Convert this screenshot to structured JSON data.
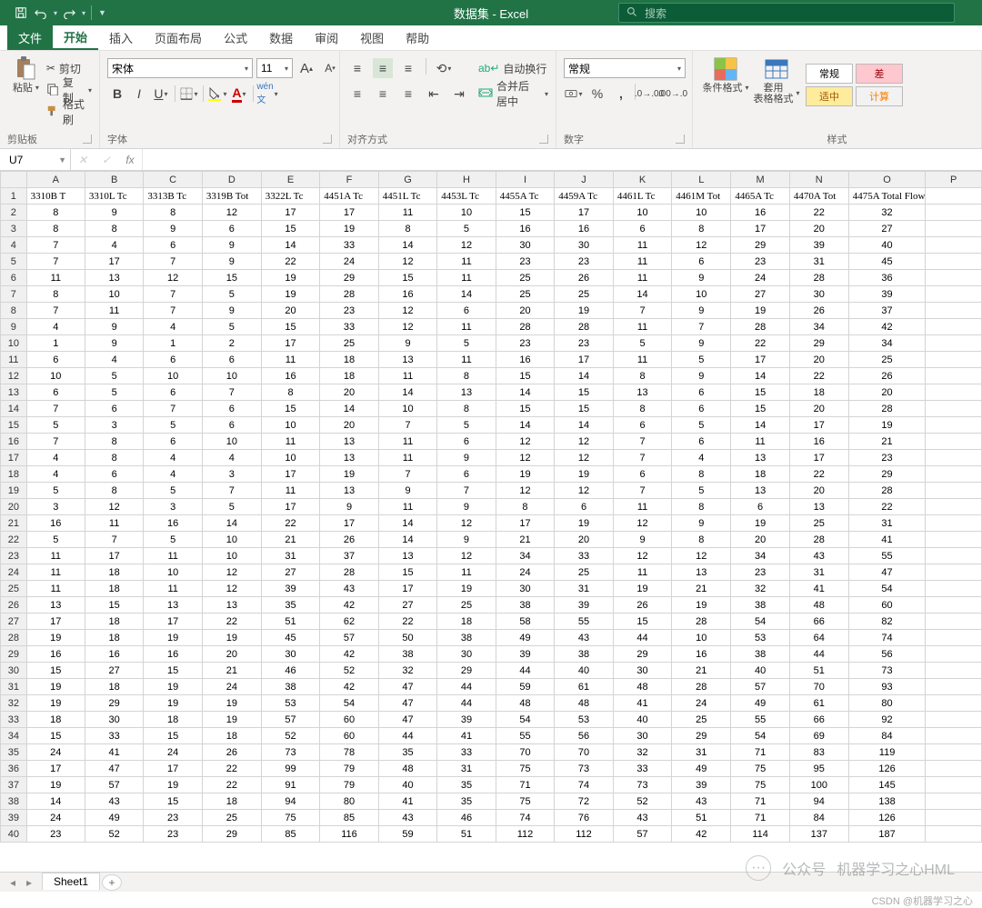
{
  "title": "数据集 - Excel",
  "search_placeholder": "搜索",
  "tabs": {
    "file": "文件",
    "home": "开始",
    "insert": "插入",
    "layout": "页面布局",
    "formulas": "公式",
    "data": "数据",
    "review": "审阅",
    "view": "视图",
    "help": "帮助"
  },
  "ribbon": {
    "clipboard": {
      "paste": "粘贴",
      "cut": "剪切",
      "copy": "复制",
      "format_painter": "格式刷",
      "label": "剪贴板"
    },
    "font": {
      "name": "宋体",
      "size": "11",
      "label": "字体"
    },
    "align": {
      "wrap": "自动换行",
      "merge": "合并后居中",
      "label": "对齐方式"
    },
    "number": {
      "fmt": "常规",
      "label": "数字"
    },
    "styles": {
      "cond": "条件格式",
      "table": "套用\n表格格式",
      "s1": "常规",
      "s2": "差",
      "s3": "适中",
      "s4": "计算",
      "label": "样式"
    }
  },
  "namebox": "U7",
  "columns": [
    "A",
    "B",
    "C",
    "D",
    "E",
    "F",
    "G",
    "H",
    "I",
    "J",
    "K",
    "L",
    "M",
    "N",
    "O",
    "P"
  ],
  "headerRow": [
    "3310B T",
    "3310L Tc",
    "3313B Tc",
    "3319B Tot",
    "3322L Tc",
    "4451A Tc",
    "4451L Tc",
    "4453L Tc",
    "4455A Tc",
    "4459A Tc",
    "4461L Tc",
    "4461M Tot",
    "4465A Tc",
    "4470A Tot",
    "4475A Total Flow",
    ""
  ],
  "rows": [
    [
      8,
      9,
      8,
      12,
      17,
      17,
      11,
      10,
      15,
      17,
      10,
      10,
      16,
      22,
      32,
      ""
    ],
    [
      8,
      8,
      9,
      6,
      15,
      19,
      8,
      5,
      16,
      16,
      6,
      8,
      17,
      20,
      27,
      ""
    ],
    [
      7,
      4,
      6,
      9,
      14,
      33,
      14,
      12,
      30,
      30,
      11,
      12,
      29,
      39,
      40,
      ""
    ],
    [
      7,
      17,
      7,
      9,
      22,
      24,
      12,
      11,
      23,
      23,
      11,
      6,
      23,
      31,
      45,
      ""
    ],
    [
      11,
      13,
      12,
      15,
      19,
      29,
      15,
      11,
      25,
      26,
      11,
      9,
      24,
      28,
      36,
      ""
    ],
    [
      8,
      10,
      7,
      5,
      19,
      28,
      16,
      14,
      25,
      25,
      14,
      10,
      27,
      30,
      39,
      ""
    ],
    [
      7,
      11,
      7,
      9,
      20,
      23,
      12,
      6,
      20,
      19,
      7,
      9,
      19,
      26,
      37,
      ""
    ],
    [
      4,
      9,
      4,
      5,
      15,
      33,
      12,
      11,
      28,
      28,
      11,
      7,
      28,
      34,
      42,
      ""
    ],
    [
      1,
      9,
      1,
      2,
      17,
      25,
      9,
      5,
      23,
      23,
      5,
      9,
      22,
      29,
      34,
      ""
    ],
    [
      6,
      4,
      6,
      6,
      11,
      18,
      13,
      11,
      16,
      17,
      11,
      5,
      17,
      20,
      25,
      ""
    ],
    [
      10,
      5,
      10,
      10,
      16,
      18,
      11,
      8,
      15,
      14,
      8,
      9,
      14,
      22,
      26,
      ""
    ],
    [
      6,
      5,
      6,
      7,
      8,
      20,
      14,
      13,
      14,
      15,
      13,
      6,
      15,
      18,
      20,
      ""
    ],
    [
      7,
      6,
      7,
      6,
      15,
      14,
      10,
      8,
      15,
      15,
      8,
      6,
      15,
      20,
      28,
      ""
    ],
    [
      5,
      3,
      5,
      6,
      10,
      20,
      7,
      5,
      14,
      14,
      6,
      5,
      14,
      17,
      19,
      ""
    ],
    [
      7,
      8,
      6,
      10,
      11,
      13,
      11,
      6,
      12,
      12,
      7,
      6,
      11,
      16,
      21,
      ""
    ],
    [
      4,
      8,
      4,
      4,
      10,
      13,
      11,
      9,
      12,
      12,
      7,
      4,
      13,
      17,
      23,
      ""
    ],
    [
      4,
      6,
      4,
      3,
      17,
      19,
      7,
      6,
      19,
      19,
      6,
      8,
      18,
      22,
      29,
      ""
    ],
    [
      5,
      8,
      5,
      7,
      11,
      13,
      9,
      7,
      12,
      12,
      7,
      5,
      13,
      20,
      28,
      ""
    ],
    [
      3,
      12,
      3,
      5,
      17,
      9,
      11,
      9,
      8,
      6,
      11,
      8,
      6,
      13,
      22,
      ""
    ],
    [
      16,
      11,
      16,
      14,
      22,
      17,
      14,
      12,
      17,
      19,
      12,
      9,
      19,
      25,
      31,
      ""
    ],
    [
      5,
      7,
      5,
      10,
      21,
      26,
      14,
      9,
      21,
      20,
      9,
      8,
      20,
      28,
      41,
      ""
    ],
    [
      11,
      17,
      11,
      10,
      31,
      37,
      13,
      12,
      34,
      33,
      12,
      12,
      34,
      43,
      55,
      ""
    ],
    [
      11,
      18,
      10,
      12,
      27,
      28,
      15,
      11,
      24,
      25,
      11,
      13,
      23,
      31,
      47,
      ""
    ],
    [
      11,
      18,
      11,
      12,
      39,
      43,
      17,
      19,
      30,
      31,
      19,
      21,
      32,
      41,
      54,
      ""
    ],
    [
      13,
      15,
      13,
      13,
      35,
      42,
      27,
      25,
      38,
      39,
      26,
      19,
      38,
      48,
      60,
      ""
    ],
    [
      17,
      18,
      17,
      22,
      51,
      62,
      22,
      18,
      58,
      55,
      15,
      28,
      54,
      66,
      82,
      ""
    ],
    [
      19,
      18,
      19,
      19,
      45,
      57,
      50,
      38,
      49,
      43,
      44,
      10,
      53,
      64,
      74,
      ""
    ],
    [
      16,
      16,
      16,
      20,
      30,
      42,
      38,
      30,
      39,
      38,
      29,
      16,
      38,
      44,
      56,
      ""
    ],
    [
      15,
      27,
      15,
      21,
      46,
      52,
      32,
      29,
      44,
      40,
      30,
      21,
      40,
      51,
      73,
      ""
    ],
    [
      19,
      18,
      19,
      24,
      38,
      42,
      47,
      44,
      59,
      61,
      48,
      28,
      57,
      70,
      93,
      ""
    ],
    [
      19,
      29,
      19,
      19,
      53,
      54,
      47,
      44,
      48,
      48,
      41,
      24,
      49,
      61,
      80,
      ""
    ],
    [
      18,
      30,
      18,
      19,
      57,
      60,
      47,
      39,
      54,
      53,
      40,
      25,
      55,
      66,
      92,
      ""
    ],
    [
      15,
      33,
      15,
      18,
      52,
      60,
      44,
      41,
      55,
      56,
      30,
      29,
      54,
      69,
      84,
      ""
    ],
    [
      24,
      41,
      24,
      26,
      73,
      78,
      35,
      33,
      70,
      70,
      32,
      31,
      71,
      83,
      119,
      ""
    ],
    [
      17,
      47,
      17,
      22,
      99,
      79,
      48,
      31,
      75,
      73,
      33,
      49,
      75,
      95,
      126,
      ""
    ],
    [
      19,
      57,
      19,
      22,
      91,
      79,
      40,
      35,
      71,
      74,
      73,
      39,
      75,
      100,
      145,
      ""
    ],
    [
      14,
      43,
      15,
      18,
      94,
      80,
      41,
      35,
      75,
      72,
      52,
      43,
      71,
      94,
      138,
      ""
    ],
    [
      24,
      49,
      23,
      25,
      75,
      85,
      43,
      46,
      74,
      76,
      43,
      51,
      71,
      84,
      126,
      ""
    ],
    [
      23,
      52,
      23,
      29,
      85,
      116,
      59,
      51,
      112,
      112,
      57,
      42,
      114,
      137,
      187,
      ""
    ]
  ],
  "sheet": "Sheet1",
  "watermark": {
    "left": "公众号",
    "right": "机器学习之心HML"
  },
  "footnote": "CSDN @机器学习之心"
}
